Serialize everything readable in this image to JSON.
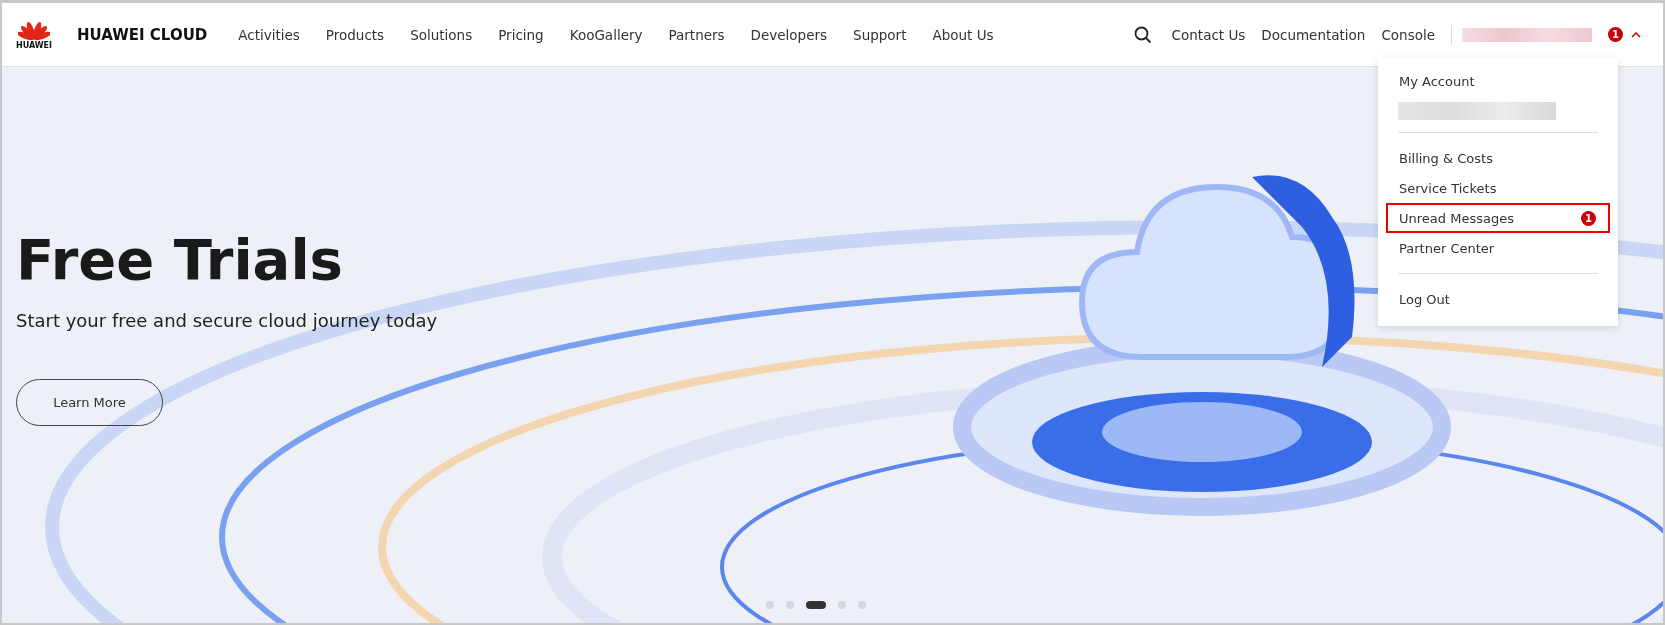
{
  "header": {
    "logo_text": "HUAWEI",
    "brand": "HUAWEI CLOUD",
    "nav": [
      "Activities",
      "Products",
      "Solutions",
      "Pricing",
      "KooGallery",
      "Partners",
      "Developers",
      "Support",
      "About Us"
    ],
    "links": [
      "Contact Us",
      "Documentation",
      "Console"
    ],
    "notification_badge": "1"
  },
  "account_menu": {
    "expanded": true,
    "items": [
      {
        "kind": "item",
        "label": "My Account",
        "highlighted": false
      },
      {
        "kind": "redacted"
      },
      {
        "kind": "divider"
      },
      {
        "kind": "item",
        "label": "Billing & Costs",
        "highlighted": false
      },
      {
        "kind": "item",
        "label": "Service Tickets",
        "highlighted": false
      },
      {
        "kind": "item",
        "label": "Unread Messages",
        "badge": "1",
        "highlighted": true
      },
      {
        "kind": "item",
        "label": "Partner Center",
        "highlighted": false
      },
      {
        "kind": "divider"
      },
      {
        "kind": "item",
        "label": "Log Out",
        "highlighted": false
      }
    ]
  },
  "hero": {
    "title": "Free Trials",
    "subtitle": "Start your free and secure cloud journey today",
    "button": "Learn More",
    "carousel": [
      {
        "selected": false
      },
      {
        "selected": false
      },
      {
        "selected": true
      },
      {
        "selected": false
      },
      {
        "selected": false
      }
    ]
  }
}
